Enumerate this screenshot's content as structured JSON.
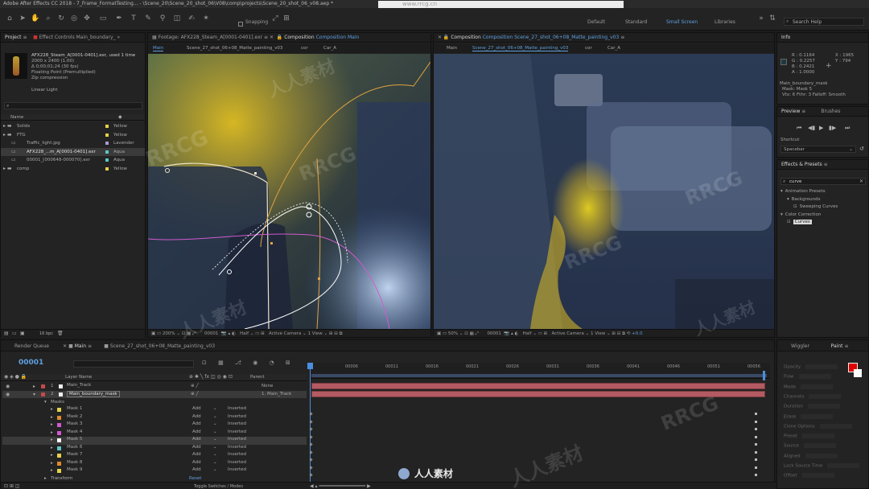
{
  "app": {
    "title": "Adobe After Effects CC 2018 - 7_Frame_FormatTesting... - \\Scene_20\\Scene_20_shot_06\\V08\\comp\\projects\\Scene_20_shot_06_v08.aep *",
    "watermark_top": "www.rrcg.cn"
  },
  "toolbar": {
    "snapping_label": "Snapping",
    "workspaces": [
      "Default",
      "Standard",
      "Small Screen",
      "Libraries"
    ],
    "search_label": "Search Help"
  },
  "project_panel": {
    "tab": "Project",
    "effect_tab": "Effect Controls Main_boundary_",
    "asset_name": "AFX228_Steam_A[0001-0401].exr",
    "asset_used": ", used 1 time",
    "asset_meta": [
      "2000 x 2400 (1.00)",
      "Δ 0;00;01;24 (30 fps)",
      "Floating Point (Premultiplied)",
      "Zip compression"
    ],
    "linear_light": "Linear Light",
    "col_name": "Name",
    "rows": [
      {
        "name": "Solids",
        "label": "Yellow",
        "color": "#e3d24a",
        "indent": 0,
        "type": "folder"
      },
      {
        "name": "FTG",
        "label": "Yellow",
        "color": "#e3d24a",
        "indent": 0,
        "type": "folder"
      },
      {
        "name": "Traffic_light.jpg",
        "label": "Lavender",
        "color": "#a99ad6",
        "indent": 1,
        "type": "file"
      },
      {
        "name": "AFX228_...m_A[0001-0401].exr",
        "label": "Aqua",
        "color": "#5cc7c7",
        "indent": 1,
        "type": "file",
        "selected": true
      },
      {
        "name": "00001_[000648-000070].exr",
        "label": "Aqua",
        "color": "#5cc7c7",
        "indent": 1,
        "type": "file"
      },
      {
        "name": "comp",
        "label": "Yellow",
        "color": "#e3d24a",
        "indent": 0,
        "type": "folder"
      }
    ],
    "bpc": "16 bpc"
  },
  "viewer_left": {
    "footage_tab": "Footage: AFX228_Steam_A[0001-0401].exr",
    "comp_tab": "Composition Main",
    "breadcrumbs": [
      "Main",
      "Scene_27_shot_06+08_Matte_painting_v03",
      "cor",
      "Car_A"
    ],
    "zoom": "200%",
    "frame": "00001",
    "resolution": "Half",
    "camera": "Active Camera",
    "views": "1 View"
  },
  "viewer_right": {
    "comp_tab": "Composition Scene_27_shot_06+08_Matte_painting_v03",
    "breadcrumbs": [
      "Main",
      "Scene_27_shot_06+08_Matte_painting_v03",
      "cor",
      "Car_A"
    ],
    "zoom": "50%",
    "frame": "00001",
    "resolution": "Half",
    "camera": "Active Camera",
    "views": "1 View",
    "offset": "+0.0"
  },
  "info_panel": {
    "tab": "Info",
    "r": "R : 0.1164",
    "g": "G : 0.2257",
    "b": "B : 0.2421",
    "a": "A : 1.0000",
    "x": "X : 1965",
    "y": "Y : 794",
    "layer": "Main_boundary_mask",
    "mask": "Mask: Mask 5",
    "vtx": "Vtx: 6  Fthr: 3  Falloff: Smooth"
  },
  "preview_panel": {
    "tab": "Preview",
    "brushes_tab": "Brushes",
    "shortcut_label": "Shortcut",
    "shortcut_value": "Spacebar"
  },
  "effects_panel": {
    "tab": "Effects & Presets",
    "search_value": "curve",
    "items": [
      {
        "label": "Animation Presets",
        "indent": 0
      },
      {
        "label": "Backgrounds",
        "indent": 1
      },
      {
        "label": "Sweeping Curves",
        "indent": 2
      },
      {
        "label": "Color Correction",
        "indent": 0
      },
      {
        "label": "Curves",
        "indent": 1,
        "selected": true
      }
    ]
  },
  "paint_panel": {
    "wiggler_tab": "Wiggler",
    "paint_tab": "Paint",
    "fg_color": "#e00000",
    "fields": [
      "Opacity",
      "Flow",
      "Mode",
      "Channels",
      "Duration",
      "Erase",
      "Clone Options",
      "Preset",
      "Source",
      "Aligned",
      "Lock Source Time",
      "Offset"
    ]
  },
  "timeline": {
    "render_queue_tab": "Render Queue",
    "main_tab": "Main",
    "comp_tab": "Scene_27_shot_06+08_Matte_painting_v03",
    "current_time": "00001",
    "col_layer_name": "Layer Name",
    "col_parent": "Parent",
    "ruler": [
      "00006",
      "00011",
      "00016",
      "00021",
      "00026",
      "00031",
      "00036",
      "00041",
      "00046",
      "00051",
      "00056"
    ],
    "layers": [
      {
        "num": "1",
        "name": "Main_Track",
        "parent": "None",
        "color": "#c24a4a"
      },
      {
        "num": "2",
        "name": "Main_boundary_mask",
        "parent": "1. Main_Track",
        "color": "#c24a4a"
      }
    ],
    "masks_label": "Masks",
    "masks": [
      {
        "name": "Mask 1",
        "color": "#e3d24a",
        "mode": "Add",
        "inverted": "Inverted"
      },
      {
        "name": "Mask 2",
        "color": "#e08a2c",
        "mode": "Add",
        "inverted": "Inverted"
      },
      {
        "name": "Mask 3",
        "color": "#d05ad0",
        "mode": "Add",
        "inverted": "Inverted"
      },
      {
        "name": "Mask 4",
        "color": "#d05ad0",
        "mode": "Add",
        "inverted": "Inverted"
      },
      {
        "name": "Mask 5",
        "color": "#ffffff",
        "mode": "Add",
        "inverted": "Inverted",
        "selected": true
      },
      {
        "name": "Mask 6",
        "color": "#5cc7c7",
        "mode": "Add",
        "inverted": "Inverted"
      },
      {
        "name": "Mask 7",
        "color": "#e3d24a",
        "mode": "Add",
        "inverted": "Inverted"
      },
      {
        "name": "Mask 8",
        "color": "#e08a2c",
        "mode": "Add",
        "inverted": "Inverted"
      },
      {
        "name": "Mask 9",
        "color": "#e3d24a",
        "mode": "Add",
        "inverted": "Inverted"
      }
    ],
    "transform_label": "Transform",
    "reset_label": "Reset",
    "toggle_label": "Toggle Switches / Modes"
  },
  "watermarks": [
    "RRCG",
    "人人素材",
    "人人素材",
    "RRCG",
    "人人素材",
    "RRCG",
    "RRCG",
    "人人素材",
    "RRCG"
  ],
  "bottom_logo": "人人素材"
}
